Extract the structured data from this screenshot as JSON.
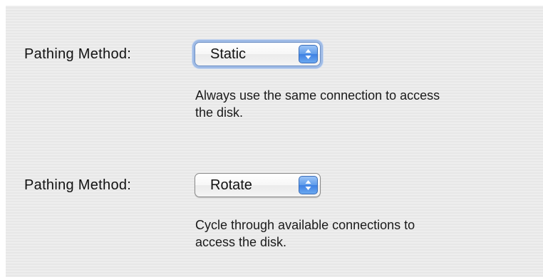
{
  "groups": [
    {
      "label": "Pathing Method:",
      "popup": {
        "value": "Static",
        "focused": true
      },
      "description_line1": "Always use the same connection to access",
      "description_line2": "the disk."
    },
    {
      "label": "Pathing Method:",
      "popup": {
        "value": "Rotate",
        "focused": false
      },
      "description_line1": "Cycle through available connections to",
      "description_line2": "access the disk."
    }
  ],
  "icons": {
    "popup_arrows": "up-down-arrows-icon"
  },
  "colors": {
    "panel_background": "#ececec",
    "focus_ring": "#9fbbe6",
    "arrow_button": "#5e9bea"
  }
}
